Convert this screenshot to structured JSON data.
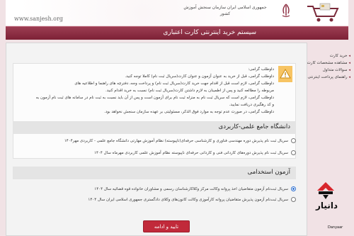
{
  "header": {
    "site_url": "www.sanjesh.org",
    "org_title": "جمهوری اسلامی ایران سازمان سنجش آموزش کشور"
  },
  "titlebar": {
    "title": "سیستم خرید اینترنتی کارت اعتباری"
  },
  "sidebar": {
    "items": [
      {
        "label": "خرید کارت"
      },
      {
        "label": "مشاهده مشخصات کارت"
      },
      {
        "label": "سوالات متداول"
      },
      {
        "label": "راهنمای پرداخت اینترنتی"
      }
    ]
  },
  "notice": {
    "lines": [
      "داوطلب گرامی:",
      "داوطلب گرامی، قبل از خرید به عنوان آزمون و عنوان کارت(سریال ثبت نام) کاملا توجه کنید.",
      "داوطلب گرامی، لازم است قبل از اقدام جهت خرید کارت(سریال ثبت نام) و پرداخت وجه، دفترچه های راهنما و اطلاعیه های",
      "مربوطه را مطالعه کنید و پس از اطمینان به لازم داشتن کارت(سریال ثبت نام) نسبت به خرید اقدام کنید.",
      "داوطلب گرامی، لازم است که سریال ثبت نام به منزله ثبت نام برای آزمون است و پس از آن باید نسبت به ثبت نام در سامانه های ثبت نام آزمون به",
      "و کد رهگیری دریافت نمایید.",
      "داوطلب گرامی، در صورت عدم توجه به موارد فوق الذکر، مسئولیتی بر عهده سازمان سنجش نخواهد بود."
    ]
  },
  "sections": [
    {
      "title": "دانشگاه جامع علمی-کاربردی",
      "options": [
        {
          "label": "سریال ثبت نام پذیرش دوره مهندسی فناوری و کارشناسی حرفه‌ای(ناپیوسته) نظام آموزش مهارتی دانشگاه جامع علمی - کاربردی مهر۱۴۰۴",
          "checked": false
        },
        {
          "label": "سریال ثبت نام پذیرش دوره‌های کاردانی فنی و کاردانی حرفه‌ای ناپیوسته نظام آموزش علمی کاربردی مهرماه سال ۱۴۰۴",
          "checked": false
        }
      ]
    },
    {
      "title": "آزمون استخدامی",
      "options": [
        {
          "label": "سریال ثبت‌نام آزمون متقاضیان اخذ پروانه وکالت مرکز وکلاکارشناسان رسمی و مشاوران خانواده قوه قضائیه سال ۱۴۰۴",
          "checked": true
        },
        {
          "label": "سریال ثبت‌نام آزمون پذیرش متقاضیان پروانه کارآموزی وکالت کانون‌های وکلای دادگستری جمهوری اسلامی ایران سال ۱۴۰۴",
          "checked": false
        }
      ]
    }
  ],
  "submit": {
    "label": "تایید و ادامه"
  },
  "watermark": {
    "name": "دانیار",
    "sub": "Danyaar"
  },
  "colors": {
    "brand": "#8b2a3e",
    "button": "#c12a3a",
    "notice_icon": "#f7c463"
  }
}
